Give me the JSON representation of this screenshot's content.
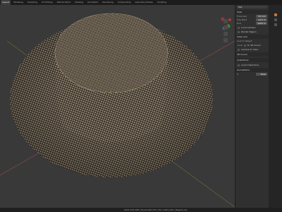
{
  "workspace_tabs": [
    "Layout",
    "Modeling",
    "Sculpting",
    "UV Editing",
    "Texture Paint",
    "Shading",
    "Animation",
    "Rendering",
    "Compositing",
    "Geometry Nodes",
    "Scripting"
  ],
  "active_tab_index": 0,
  "gizmo": {
    "x": "X",
    "y": "Y",
    "z": "Z"
  },
  "properties": {
    "title": "Hat",
    "section_view": "View",
    "rows": [
      {
        "label": "Focal Len",
        "value": "50 mm"
      },
      {
        "label": "Clip Start",
        "value": "0.01 m"
      },
      {
        "label": "End",
        "value": "1000 m"
      }
    ],
    "local_camera_label": "Local Camera",
    "render_region_label": "Render Region",
    "section_view_lock": "View Lock",
    "lock_rows": [
      {
        "label": "Lock to Object",
        "value": ""
      },
      {
        "label": "Lock",
        "value": "To 3D Cursor",
        "checked": false
      },
      {
        "label": "",
        "value": "Camera to View",
        "checked": false
      }
    ],
    "section_3d_cursor": "3D Cursor",
    "section_collections": "Collections",
    "collections_row": "Local Collections",
    "section_annotations": "Annotations",
    "annotation_value": "Note"
  },
  "status_text": "Verts 270,368 | Faces 540,720 | Tris 1,081,440 | Objects 1/1"
}
